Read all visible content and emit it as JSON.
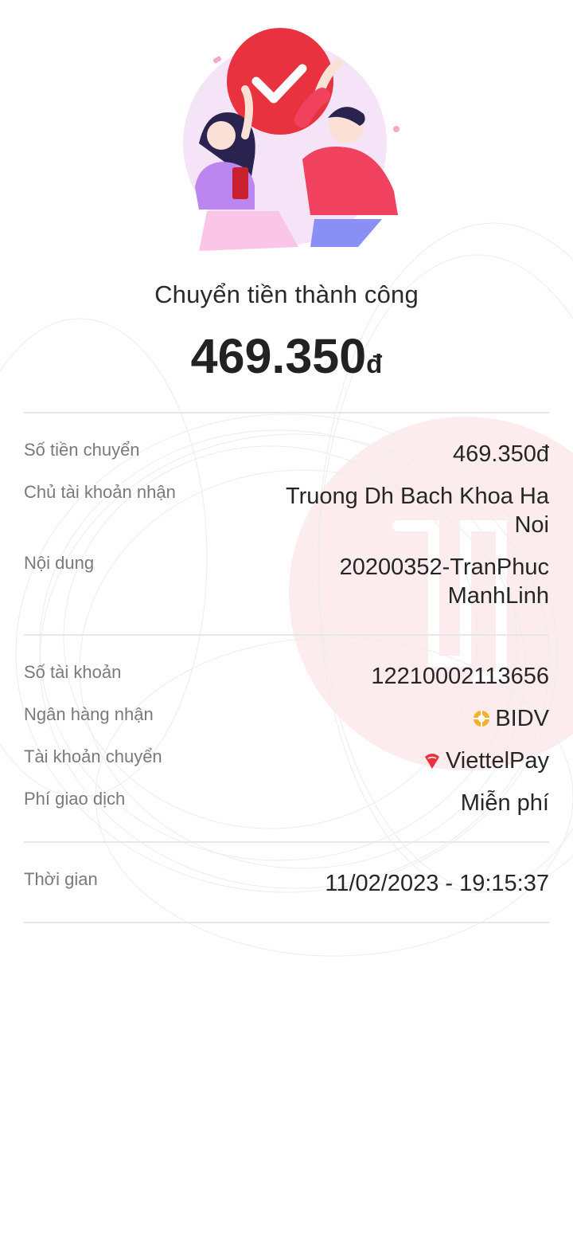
{
  "result": {
    "title": "Chuyển tiền thành công",
    "amount": "469.350",
    "currency": "đ"
  },
  "details": {
    "amount_label": "Số tiền chuyển",
    "amount_value": "469.350đ",
    "recipient_label": "Chủ tài khoản nhận",
    "recipient_line1": "Truong Dh Bach Khoa Ha",
    "recipient_line2": "Noi",
    "content_label": "Nội dung",
    "content_line1": "20200352-TranPhuc",
    "content_line2": "ManhLinh"
  },
  "account": {
    "account_number_label": "Số tài khoản",
    "account_number_value": "12210002113656",
    "bank_label": "Ngân hàng nhận",
    "bank_value": "BIDV",
    "bank_icon": "bidv-logo-icon",
    "source_label": "Tài khoản chuyển",
    "source_value": "ViettelPay",
    "source_icon": "viettelpay-logo-icon",
    "fee_label": "Phí giao dịch",
    "fee_value": "Miễn phí"
  },
  "time": {
    "label": "Thời gian",
    "value": "11/02/2023 - 19:15:37"
  },
  "colors": {
    "accent_red": "#e8323f",
    "watermark_pink": "#fde7ea",
    "bidv_gold": "#f3b12a"
  }
}
